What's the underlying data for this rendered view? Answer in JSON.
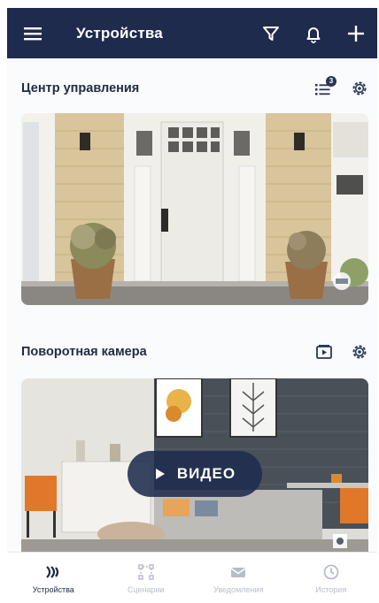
{
  "header": {
    "title": "Устройства",
    "menu_icon": "menu-icon",
    "filter_icon": "filter-icon",
    "bell_icon": "bell-icon",
    "add_icon": "plus-icon",
    "background_color": "#1f2b4d"
  },
  "devices": [
    {
      "name": "Центр управления",
      "list_badge": "3",
      "icons": [
        "list-icon",
        "gear-icon"
      ]
    },
    {
      "name": "Поворотная камера",
      "icons": [
        "playback-icon",
        "gear-icon"
      ],
      "video_button": "ВИДЕО"
    }
  ],
  "bottom_nav": {
    "tabs": [
      {
        "label": "Устройства",
        "icon": "devices-icon",
        "active": true
      },
      {
        "label": "Сценарии",
        "icon": "scenarios-icon",
        "active": false
      },
      {
        "label": "Уведомления",
        "icon": "mail-icon",
        "active": false
      },
      {
        "label": "История",
        "icon": "history-icon",
        "active": false
      }
    ]
  }
}
